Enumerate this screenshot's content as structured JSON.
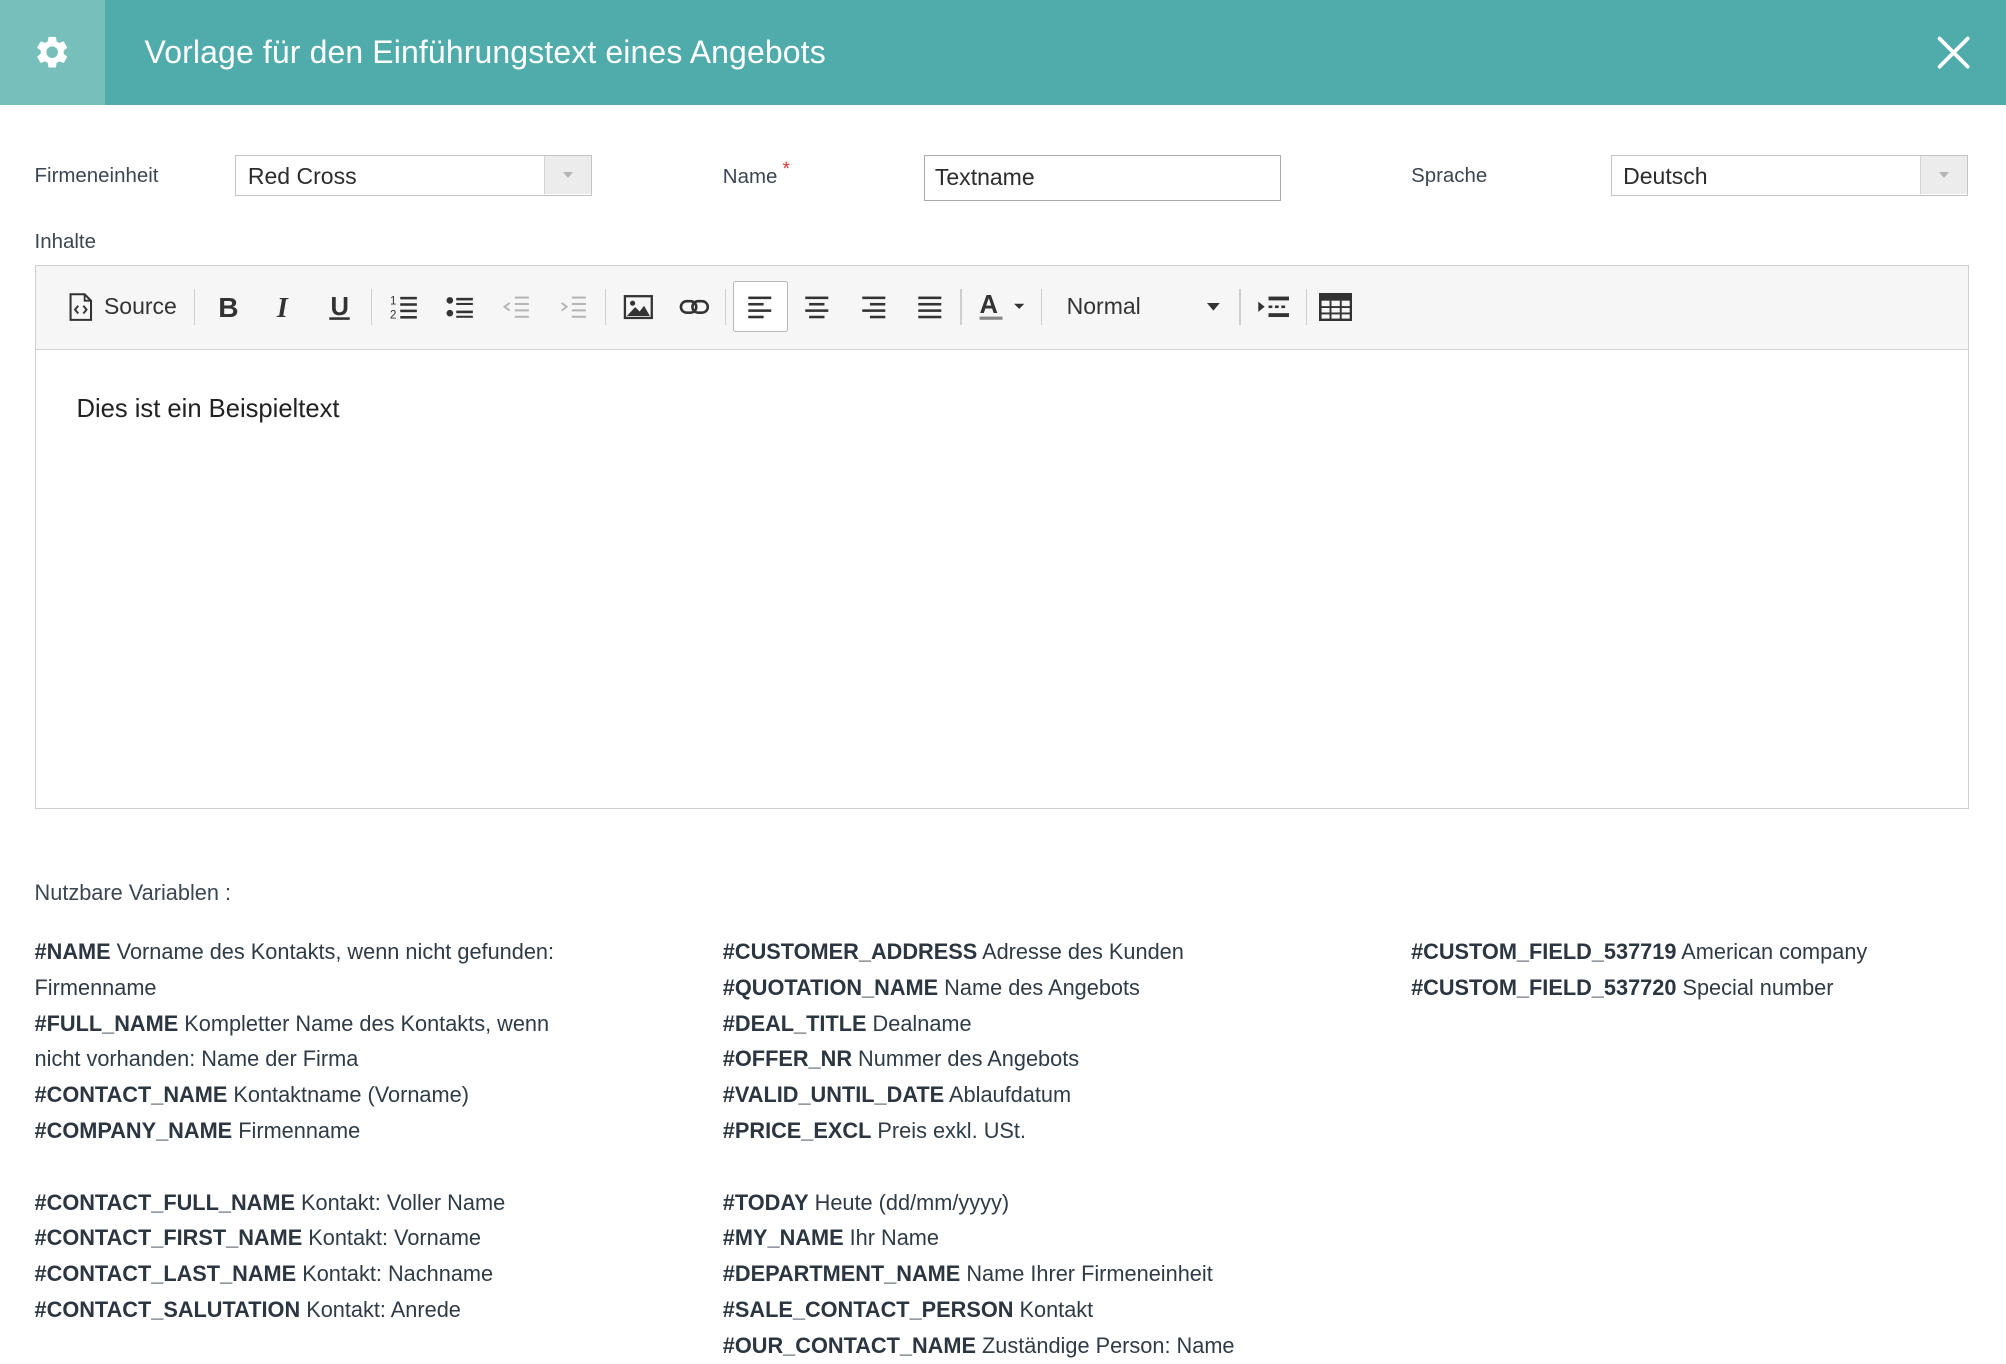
{
  "dialog": {
    "title": "Vorlage für den Einführungstext eines Angebots",
    "header_color": "#50abab"
  },
  "form": {
    "company_label": "Firmeneinheit",
    "company_value": "Red Cross",
    "name_label": "Name",
    "name_required": "*",
    "name_value": "Textname",
    "language_label": "Sprache",
    "language_value": "Deutsch",
    "content_label": "Inhalte"
  },
  "toolbar": {
    "source_label": "Source",
    "format_value": "Normal"
  },
  "editor": {
    "content": "Dies ist ein Beispieltext"
  },
  "variables": {
    "title": "Nutzbare Variablen :",
    "col1_group1": [
      {
        "key": "#NAME",
        "desc": " Vorname des Kontakts, wenn nicht gefunden:"
      },
      {
        "key": "",
        "desc": "Firmenname"
      },
      {
        "key": "#FULL_NAME",
        "desc": " Kompletter Name des Kontakts, wenn"
      },
      {
        "key": "",
        "desc": "nicht vorhanden: Name der Firma"
      },
      {
        "key": "#CONTACT_NAME",
        "desc": " Kontaktname (Vorname)"
      },
      {
        "key": "#COMPANY_NAME",
        "desc": " Firmenname"
      }
    ],
    "col1_group2": [
      {
        "key": "#CONTACT_FULL_NAME",
        "desc": " Kontakt: Voller Name"
      },
      {
        "key": "#CONTACT_FIRST_NAME",
        "desc": " Kontakt: Vorname"
      },
      {
        "key": "#CONTACT_LAST_NAME",
        "desc": " Kontakt: Nachname"
      },
      {
        "key": "#CONTACT_SALUTATION",
        "desc": " Kontakt: Anrede"
      }
    ],
    "col2_group1": [
      {
        "key": "#CUSTOMER_ADDRESS",
        "desc": " Adresse des Kunden"
      },
      {
        "key": "#QUOTATION_NAME",
        "desc": " Name des Angebots"
      },
      {
        "key": "#DEAL_TITLE",
        "desc": " Dealname"
      },
      {
        "key": "#OFFER_NR",
        "desc": " Nummer des Angebots"
      },
      {
        "key": "#VALID_UNTIL_DATE",
        "desc": " Ablaufdatum"
      },
      {
        "key": "#PRICE_EXCL",
        "desc": " Preis exkl. USt."
      }
    ],
    "col2_group2": [
      {
        "key": "#TODAY",
        "desc": " Heute (dd/mm/yyyy)"
      },
      {
        "key": "#MY_NAME",
        "desc": " Ihr Name"
      },
      {
        "key": "#DEPARTMENT_NAME",
        "desc": " Name Ihrer Firmeneinheit"
      },
      {
        "key": "#SALE_CONTACT_PERSON",
        "desc": " Kontakt"
      },
      {
        "key": "#OUR_CONTACT_NAME",
        "desc": " Zuständige Person: Name"
      }
    ],
    "col3_group1": [
      {
        "key": "#CUSTOM_FIELD_537719",
        "desc": " American company"
      },
      {
        "key": "#CUSTOM_FIELD_537720",
        "desc": " Special number"
      }
    ]
  }
}
